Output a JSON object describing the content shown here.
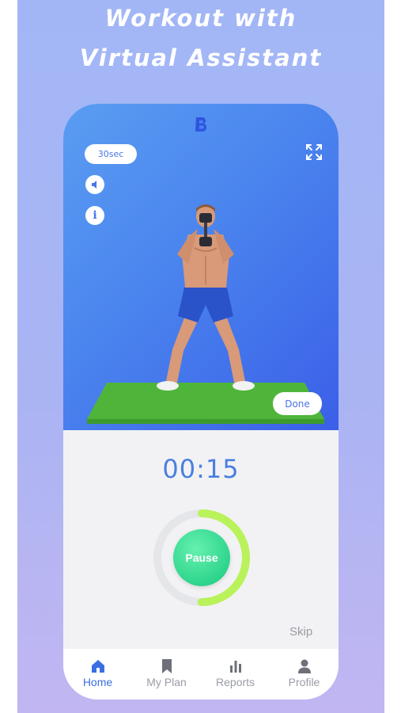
{
  "promo": {
    "headline_line1": "Workout with",
    "headline_line2": "Virtual Assistant"
  },
  "player": {
    "duration_label": "30sec",
    "done_label": "Done",
    "info_glyph": "i",
    "icons": [
      "brand-logo-icon",
      "volume-icon",
      "info-icon",
      "fullscreen-icon"
    ]
  },
  "workout": {
    "countdown": "00:15",
    "progress_fraction": 0.5,
    "pause_label": "Pause",
    "skip_label": "Skip"
  },
  "tabs": [
    {
      "label": "Home",
      "icon": "home-icon",
      "active": true
    },
    {
      "label": "My Plan",
      "icon": "bookmark-icon",
      "active": false
    },
    {
      "label": "Reports",
      "icon": "bar-chart-icon",
      "active": false
    },
    {
      "label": "Profile",
      "icon": "person-icon",
      "active": false
    }
  ],
  "colors": {
    "accent_blue": "#4a74e8",
    "progress_green": "#b9f25a",
    "pause_green": "#2ed58c",
    "mat_green": "#4fb53a"
  }
}
